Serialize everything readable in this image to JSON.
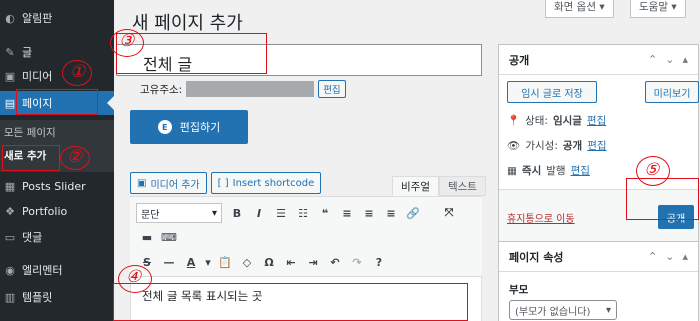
{
  "sidebar": {
    "items": [
      {
        "label": "알림판",
        "icon": "dashboard-icon",
        "glyph": "◐"
      },
      {
        "label": "글",
        "icon": "pin-icon",
        "glyph": "✎"
      },
      {
        "label": "미디어",
        "icon": "media-icon",
        "glyph": "▣"
      },
      {
        "label": "페이지",
        "icon": "page-icon",
        "glyph": "▤"
      },
      {
        "label": "Posts Slider",
        "icon": "slider-icon",
        "glyph": "▦"
      },
      {
        "label": "Portfolio",
        "icon": "portfolio-icon",
        "glyph": "❖"
      },
      {
        "label": "댓글",
        "icon": "comments-icon",
        "glyph": "▭"
      },
      {
        "label": "엘리멘터",
        "icon": "elementor-icon",
        "glyph": "◉"
      },
      {
        "label": "템플릿",
        "icon": "templates-icon",
        "glyph": "▥"
      }
    ],
    "sub_items": [
      "모든 페이지",
      "새로 추가"
    ]
  },
  "page_title": "새 페이지 추가",
  "top_buttons": {
    "screen_options": "화면 옵션 ▾",
    "help": "도움말 ▾"
  },
  "title_value": "전체 글",
  "permalink": {
    "label": "고유주소:",
    "edit": "편집"
  },
  "elementor_button": "편집하기",
  "media_button": "미디어 추가",
  "shortcode_button": "Insert shortcode",
  "editor_tabs": {
    "visual": "비주얼",
    "text": "텍스트"
  },
  "format_select": "문단",
  "toolbar_row1": [
    "B",
    "I",
    "☰",
    "☷",
    "❝",
    "≡",
    "≡",
    "≡",
    "🔗",
    "⤧"
  ],
  "toolbar_row2": [
    "▬",
    "⌨"
  ],
  "toolbar_row3": [
    "S",
    "—",
    "A",
    "▾",
    "📋",
    "◇",
    "Ω",
    "⇤",
    "⇥",
    "↶",
    "↷",
    "?"
  ],
  "editor_content": "전체 글 목록 표시되는 곳",
  "publish_panel": {
    "title": "공개",
    "save_draft": "임시 글로 저장",
    "preview": "미리보기",
    "status_label": "상태:",
    "status_value": "임시글",
    "status_edit": "편집",
    "visibility_label": "가시성:",
    "visibility_value": "공개",
    "visibility_edit": "편집",
    "publish_label": "즉시",
    "publish_text": "발행",
    "publish_edit": "편집",
    "trash": "휴지통으로 이동",
    "publish_button": "공개"
  },
  "attributes_panel": {
    "title": "페이지 속성",
    "parent_label": "부모",
    "parent_value": "(부모가 없습니다)"
  },
  "annotations": [
    "①",
    "②",
    "③",
    "④",
    "⑤"
  ],
  "colors": {
    "sidebar": "#23282d",
    "accent": "#2271b1",
    "annotation": "#e0101a"
  }
}
